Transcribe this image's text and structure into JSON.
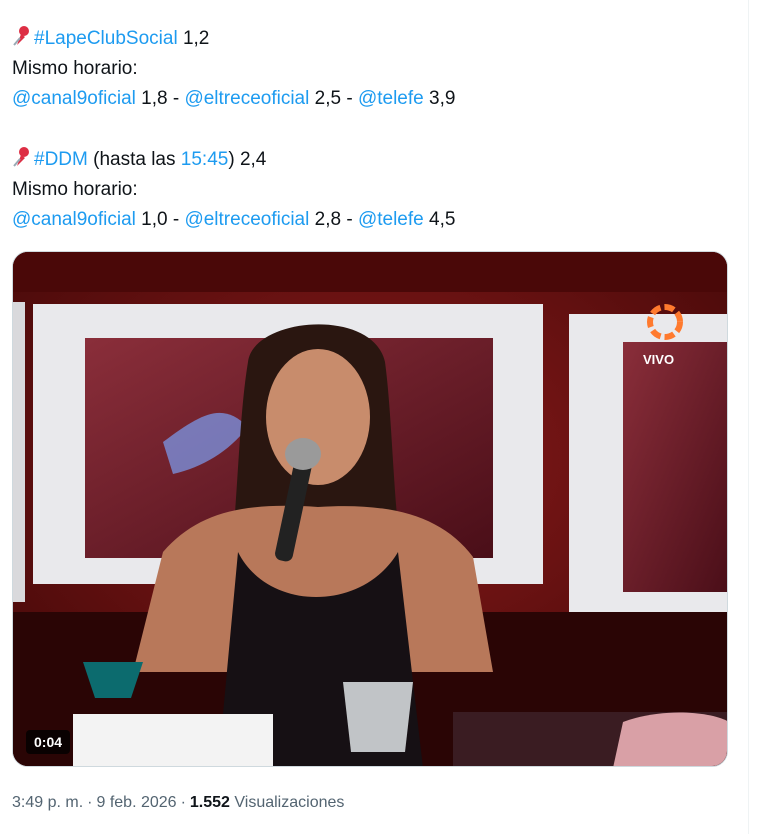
{
  "tweet": {
    "block1": {
      "hashtag": "#LapeClubSocial",
      "rating": "1,2",
      "same_time_label": "Mismo horario:",
      "channels": [
        {
          "handle": "@canal9oficial",
          "value": "1,8",
          "sep": " - "
        },
        {
          "handle": "@eltreceoficial",
          "value": "2,5",
          "sep": " - "
        },
        {
          "handle": "@telefe",
          "value": "3,9"
        }
      ]
    },
    "block2": {
      "hashtag": "#DDM",
      "paren_open": "(hasta las ",
      "time": "15:45",
      "paren_close": ")",
      "rating": "2,4",
      "same_time_label": "Mismo horario:",
      "channels": [
        {
          "handle": "@canal9oficial",
          "value": "1,0",
          "sep": " - "
        },
        {
          "handle": "@eltreceoficial",
          "value": "2,8",
          "sep": " - "
        },
        {
          "handle": "@telefe",
          "value": "4,5"
        }
      ]
    }
  },
  "media": {
    "duration": "0:04",
    "overlay_text": "VIVO",
    "icon": "pushpin-icon"
  },
  "meta": {
    "time": "3:49 p. m.",
    "dot": "·",
    "date": "9 feb. 2026",
    "views_count": "1.552",
    "views_label": "Visualizaciones"
  },
  "colors": {
    "link": "#1d9bf0",
    "text": "#0f1419",
    "secondary": "#536471"
  }
}
